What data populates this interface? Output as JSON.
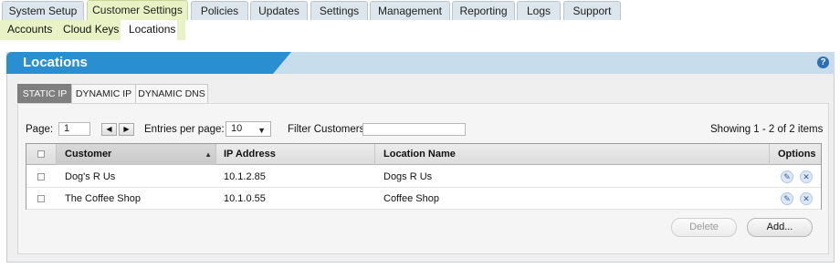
{
  "top_nav": {
    "tabs": [
      {
        "label": "System Setup",
        "active": false
      },
      {
        "label": "Customer Settings",
        "active": true
      },
      {
        "label": "Policies",
        "active": false
      },
      {
        "label": "Updates",
        "active": false
      },
      {
        "label": "Settings",
        "active": false
      },
      {
        "label": "Management",
        "active": false
      },
      {
        "label": "Reporting",
        "active": false
      },
      {
        "label": "Logs",
        "active": false
      },
      {
        "label": "Support",
        "active": false
      }
    ]
  },
  "sub_nav": {
    "items": [
      {
        "label": "Accounts",
        "active": false
      },
      {
        "label": "Cloud Keys",
        "active": false
      },
      {
        "label": "Locations",
        "active": true
      }
    ]
  },
  "panel": {
    "title": "Locations",
    "help_icon": "question-circle-icon",
    "help_glyph": "?"
  },
  "location_tabs": [
    {
      "label": "STATIC IP",
      "active": true
    },
    {
      "label": "DYNAMIC IP",
      "active": false
    },
    {
      "label": "DYNAMIC DNS",
      "active": false
    }
  ],
  "controls": {
    "page_label": "Page:",
    "page_value": "1",
    "prev_glyph": "◀",
    "next_glyph": "▶",
    "entries_label": "Entries per page:",
    "entries_value": "10",
    "dropdown_glyph": "▼",
    "filter_label": "Filter Customers:",
    "filter_value": "",
    "showing_text": "Showing 1 - 2 of 2 items"
  },
  "table": {
    "headers": {
      "customer": "Customer",
      "ip_address": "IP Address",
      "location_name": "Location Name",
      "options": "Options"
    },
    "sort_glyph": "▲",
    "rows": [
      {
        "customer": "Dog's R Us",
        "ip_address": "10.1.2.85",
        "location_name": "Dogs R Us"
      },
      {
        "customer": "The Coffee Shop",
        "ip_address": "10.1.0.55",
        "location_name": "Coffee Shop"
      }
    ],
    "edit_glyph": "✎",
    "delete_glyph": "✕"
  },
  "buttons": {
    "delete": "Delete",
    "add": "Add..."
  },
  "colors": {
    "accent_blue": "#2a8fd1",
    "active_tab_green": "#e9f2c4"
  }
}
